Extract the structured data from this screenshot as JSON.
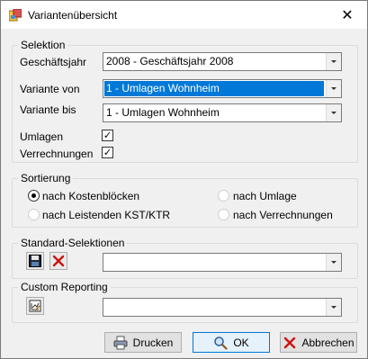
{
  "window": {
    "title": "Variantenübersicht",
    "close_glyph": "✕"
  },
  "selektion": {
    "legend": "Selektion",
    "geschaeftsjahr": {
      "label": "Geschäftsjahr",
      "value": "2008 - Geschäftsjahr 2008"
    },
    "variante_von": {
      "label": "Variante von",
      "value": "1 - Umlagen Wohnheim"
    },
    "variante_bis": {
      "label": "Variante bis",
      "value": "1 - Umlagen Wohnheim"
    },
    "umlagen": {
      "label": "Umlagen",
      "checked": true,
      "glyph": "✓"
    },
    "verrechnungen": {
      "label": "Verrechnungen",
      "checked": true,
      "glyph": "✓"
    }
  },
  "sortierung": {
    "legend": "Sortierung",
    "options": [
      {
        "label": "nach Kostenblöcken",
        "selected": true
      },
      {
        "label": "nach Umlage",
        "selected": false
      },
      {
        "label": "nach Leistenden KST/KTR",
        "selected": false
      },
      {
        "label": "nach Verrechnungen",
        "selected": false
      }
    ]
  },
  "standard_selektionen": {
    "legend": "Standard-Selektionen",
    "value": "",
    "save_icon": "save-icon",
    "delete_icon": "delete-x-icon"
  },
  "custom_reporting": {
    "legend": "Custom Reporting",
    "value": "",
    "report_icon": "report-designer-icon"
  },
  "buttons": {
    "drucken": "Drucken",
    "ok": "OK",
    "abbrechen": "Abbrechen"
  },
  "colors": {
    "selection": "#0078d7",
    "delete_red": "#d01010",
    "default_button": "#e5f1fb"
  }
}
